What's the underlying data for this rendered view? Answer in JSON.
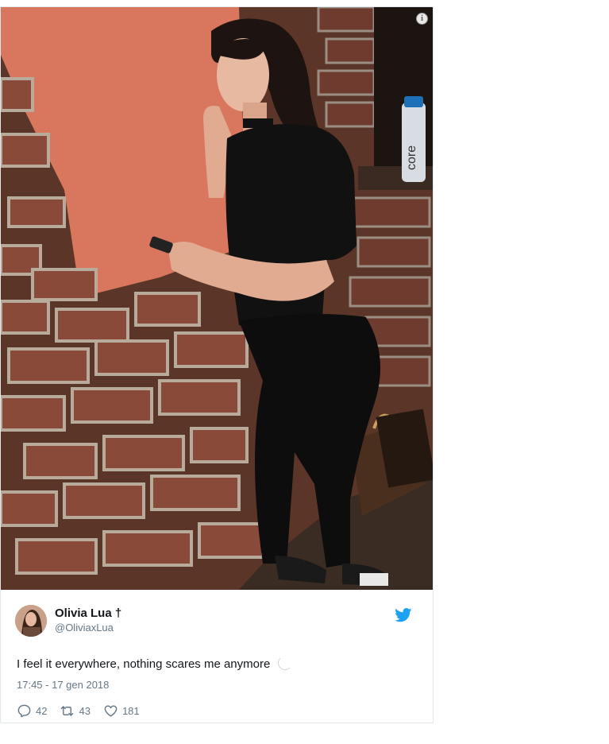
{
  "tweet": {
    "display_name": "Olivia Lua †",
    "handle": "@OliviaxLua",
    "text": "I feel it everywhere, nothing scares me anymore",
    "timestamp": "17:45 - 17 gen 2018",
    "replies": "42",
    "retweets": "43",
    "likes": "181"
  },
  "media": {
    "bottle_text": "core"
  },
  "icons": {
    "info": "info-icon",
    "bird": "twitter-bird-icon",
    "moon": "crescent-moon-icon",
    "reply": "reply-icon",
    "retweet": "retweet-icon",
    "like": "heart-icon"
  },
  "colors": {
    "brand": "#1da1f2",
    "secondary_text": "#657786",
    "primary_text": "#14171a",
    "border": "#e1e8ed"
  }
}
